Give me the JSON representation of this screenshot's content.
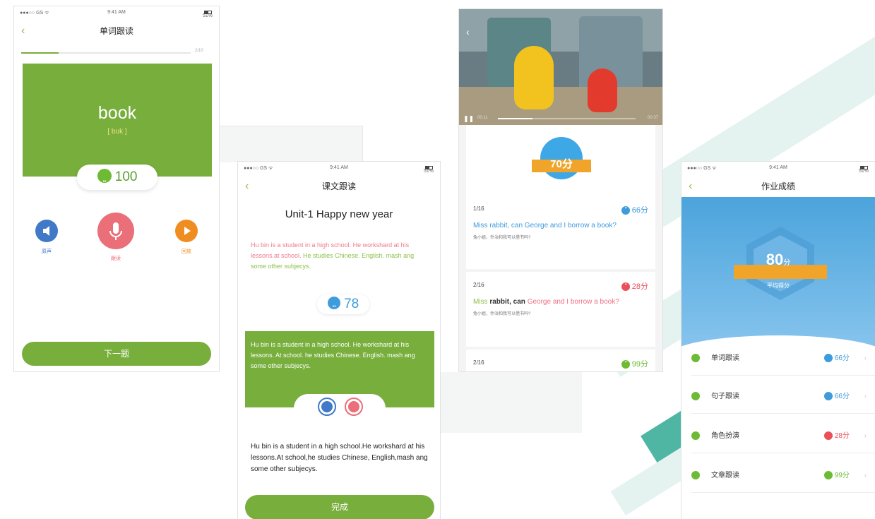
{
  "status_bar": {
    "signal": "●●●○○ GS ᯤ",
    "time": "9:41 AM",
    "battery": "51%"
  },
  "screen1": {
    "title": "单词跟读",
    "progress": {
      "fraction": 0.22,
      "label": "2/10"
    },
    "word": "book",
    "phonetic": "[ bʊk ]",
    "score": "100",
    "actions": [
      {
        "icon": "speaker-icon",
        "label": "原声",
        "color": "#3f79c7"
      },
      {
        "icon": "microphone-icon",
        "label": "跟读",
        "color": "#ea6f78"
      },
      {
        "icon": "play-icon",
        "label": "回放",
        "color": "#f08d21"
      }
    ],
    "next_button": "下一题"
  },
  "screen2": {
    "title": "课文跟读",
    "heading": "Unit-1 Happy new year",
    "passage_red": "Hu bin is a student in a high school. He workshard at his lessons.at school.",
    "passage_green": " He studies Chinese. English. mash ang some other subjecys.",
    "score": "78",
    "green_passage": "Hu bin is a student in a high school. He workshard at his lessons. At school. he studies Chinese. English. mash ang some other subjecys.",
    "plain_passage": "Hu bin is a student in a high school.He workshard at his lessons.At school,he studies Chinese, English,mash ang some other subjecys.",
    "done_button": "完成"
  },
  "screen3": {
    "video": {
      "time_current": "00:11",
      "time_total": "00:37",
      "progress": 0.25
    },
    "total_score": "70分",
    "items": [
      {
        "index": "1/16",
        "score": "66分",
        "score_color": "#3e9bdc",
        "badge": "blue",
        "en_parts": [
          {
            "t": "Miss rabbit, can George and I borrow a book?",
            "c": "#3e9bdc"
          }
        ],
        "cn": "兔小姐，乔治和我可以借书吗?"
      },
      {
        "index": "2/16",
        "score": "28分",
        "score_color": "#e9505a",
        "badge": "red",
        "en_parts": [
          {
            "t": "Miss",
            "c": "#8dbf47"
          },
          {
            "t": " rabbit,  can ",
            "c": "#333333"
          },
          {
            "t": "George and I borrow a book?",
            "c": "#ef6f86"
          }
        ],
        "cn": "兔小姐，乔治和我可以借书吗?"
      },
      {
        "index": "2/16",
        "score": "99分",
        "score_color": "#6dbb35",
        "badge": "green",
        "en_parts": [],
        "cn": ""
      }
    ]
  },
  "screen4": {
    "title": "作业成绩",
    "average_score": "80",
    "average_unit": "分",
    "average_label": "平均得分",
    "items": [
      {
        "icon": "triangle-icon",
        "label": "单词跟读",
        "score": "66分",
        "badge": "blue",
        "color": "#3e9bdc"
      },
      {
        "icon": "quote-icon",
        "label": "句子跟读",
        "score": "66分",
        "badge": "blue",
        "color": "#3e9bdc"
      },
      {
        "icon": "face-icon",
        "label": "角色扮演",
        "score": "28分",
        "badge": "red",
        "color": "#e9505a"
      },
      {
        "icon": "document-icon",
        "label": "文章跟读",
        "score": "99分",
        "badge": "green",
        "color": "#6dbb35"
      }
    ]
  }
}
